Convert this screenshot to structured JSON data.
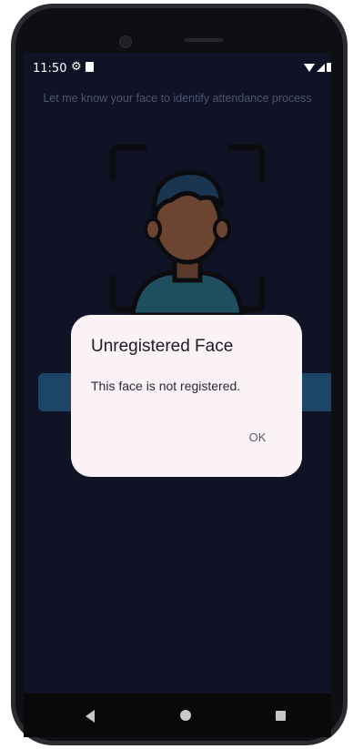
{
  "status_bar": {
    "time": "11:50",
    "icons": [
      "gear-icon",
      "sd-card-icon",
      "wifi-icon",
      "signal-icon",
      "battery-icon"
    ]
  },
  "page": {
    "instruction": "Let me know your face to identify attendance process",
    "illustration": "face-scan-icon",
    "colors": {
      "background": "#0f1325",
      "button": "#1d4666",
      "dialog": "#fbf2f8"
    }
  },
  "dialog": {
    "title": "Unregistered Face",
    "message": "This face is not registered.",
    "ok_label": "OK"
  },
  "nav_bar": {
    "icons": [
      "back-icon",
      "home-icon",
      "recents-icon"
    ]
  }
}
